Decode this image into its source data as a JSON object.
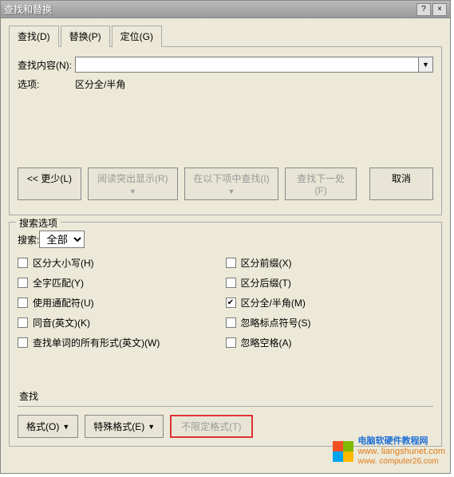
{
  "titlebar": {
    "title": "查找和替换",
    "help": "?",
    "close": "×"
  },
  "tabs": {
    "find": "查找(D)",
    "replace": "替换(P)",
    "goto": "定位(G)"
  },
  "find": {
    "contentLabel": "查找内容(N):",
    "contentValue": "",
    "optionsLabel": "选项:",
    "optionsValue": "区分全/半角"
  },
  "buttons": {
    "less": "<< 更少(L)",
    "highlight": "阅读突出显示(R)",
    "findIn": "在以下项中查找(I)",
    "findNext": "查找下一处(F)",
    "cancel": "取消"
  },
  "searchOptions": {
    "legend": "搜索选项",
    "searchLabel": "搜索:",
    "searchValue": "全部",
    "left": {
      "matchCase": "区分大小写(H)",
      "wholeWord": "全字匹配(Y)",
      "wildcard": "使用通配符(U)",
      "sounds": "同音(英文)(K)",
      "wordForms": "查找单词的所有形式(英文)(W)"
    },
    "right": {
      "prefix": "区分前缀(X)",
      "suffix": "区分后缀(T)",
      "fullHalf": "区分全/半角(M)",
      "punct": "忽略标点符号(S)",
      "space": "忽略空格(A)"
    },
    "checked": {
      "fullHalf": true
    }
  },
  "bottom": {
    "label": "查找",
    "format": "格式(O)",
    "special": "特殊格式(E)",
    "noFormat": "不限定格式(T)"
  },
  "watermark": {
    "line1": "电脑软硬件教程网",
    "line2": "www. liangshunet.com",
    "line3": "www. computer26.com"
  }
}
